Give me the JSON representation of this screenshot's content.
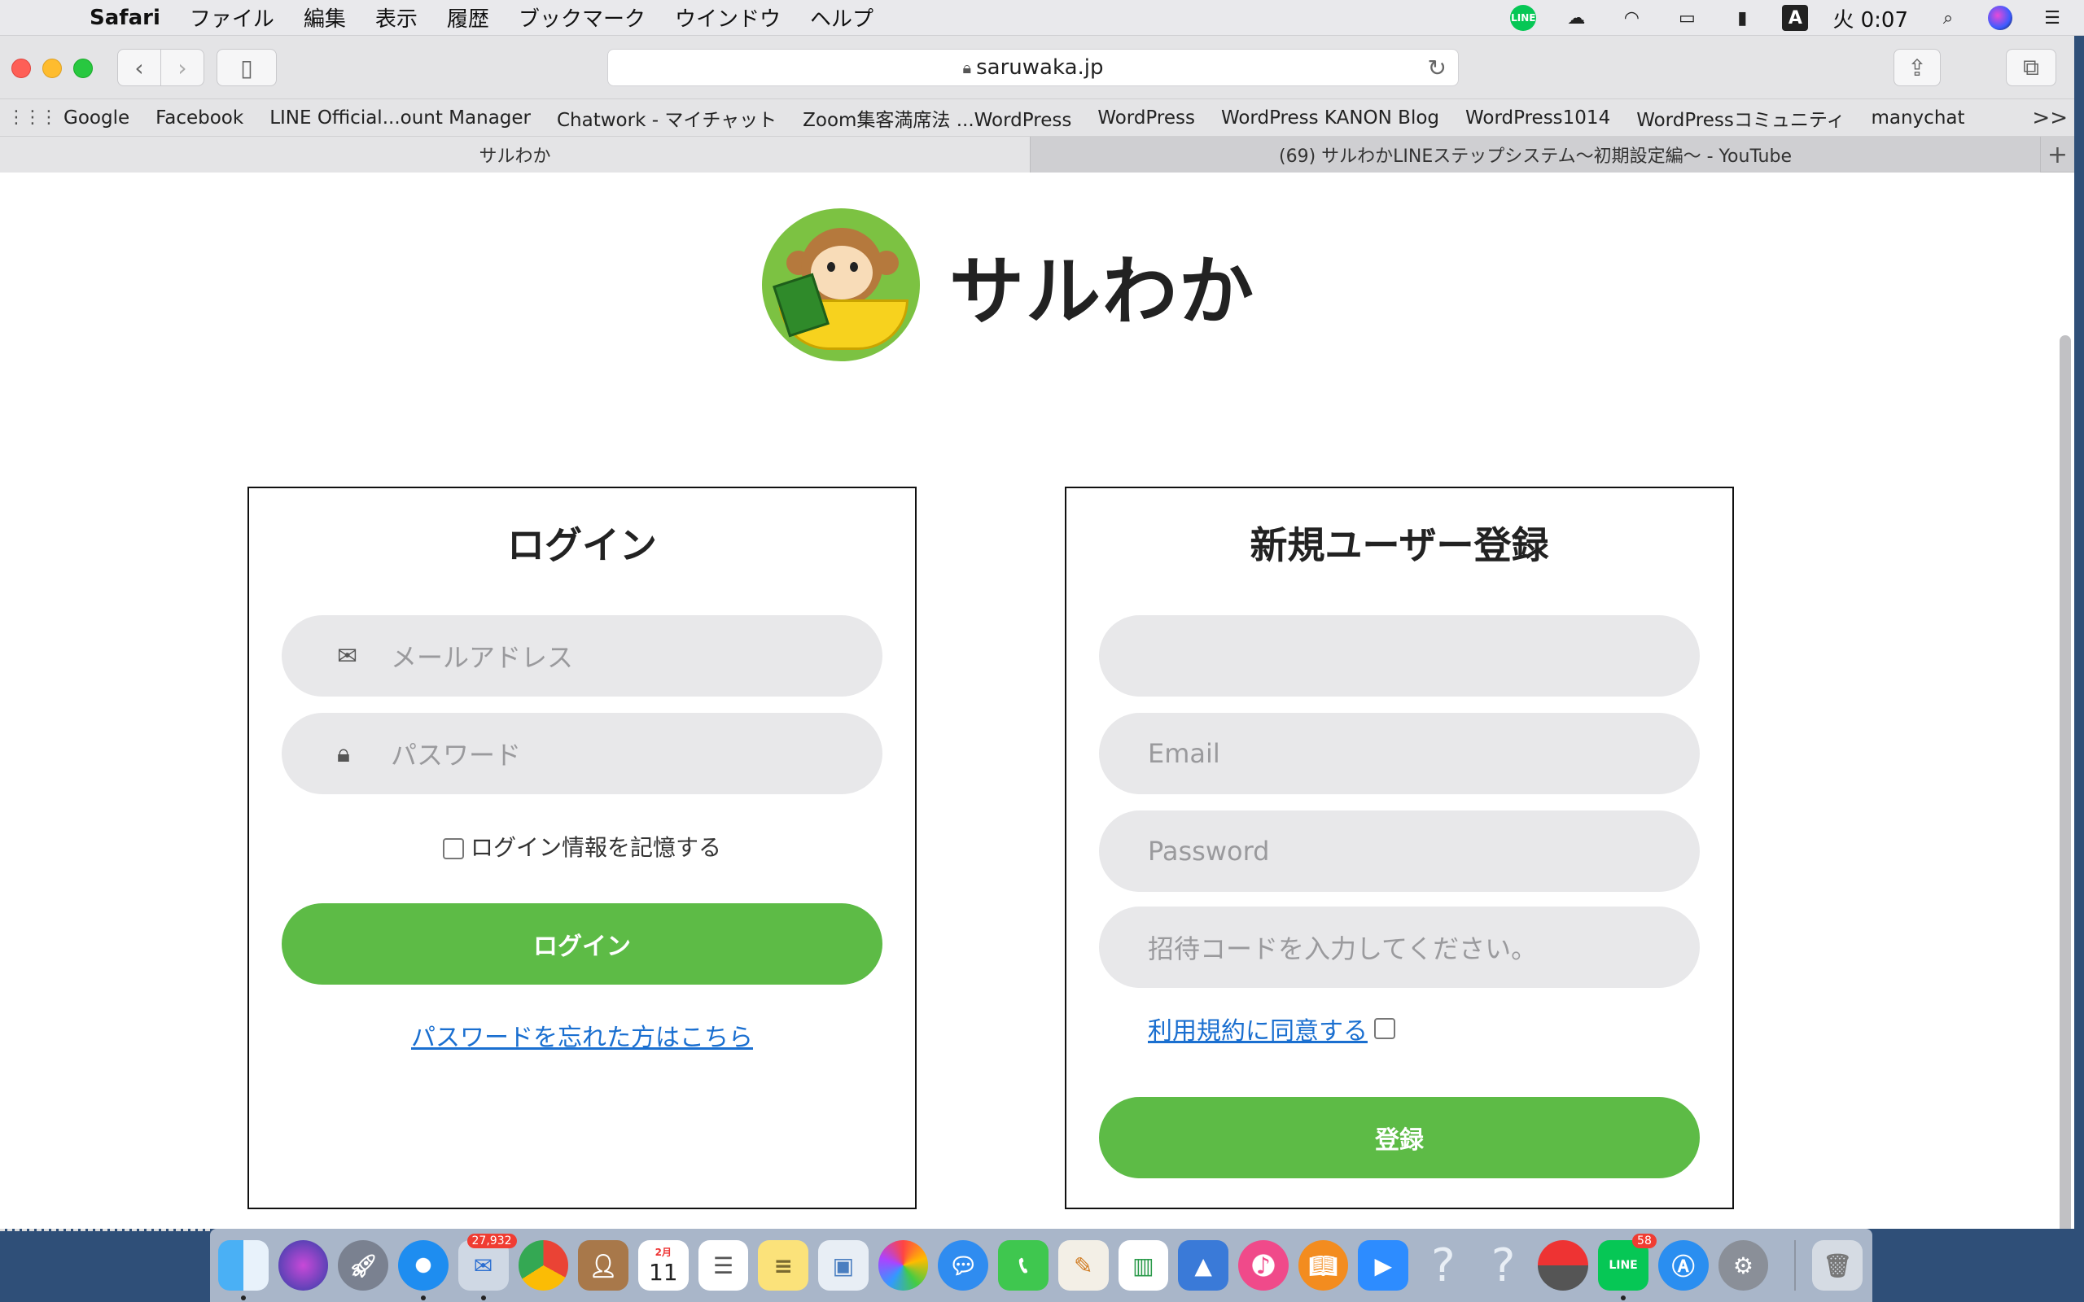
{
  "menubar": {
    "app_name": "Safari",
    "menus": [
      "ファイル",
      "編集",
      "表示",
      "履歴",
      "ブックマーク",
      "ウインドウ",
      "ヘルプ"
    ],
    "line_icon_label": "LINE",
    "input_source": "A",
    "clock": "火 0:07"
  },
  "browser": {
    "url": "saruwaka.jp",
    "bookmarks": [
      "Google",
      "Facebook",
      "LINE Official...ount Manager",
      "Chatwork - マイチャット",
      "Zoom集客満席法 ...WordPress",
      "WordPress",
      "WordPress KANON Blog",
      "WordPress1014",
      "WordPressコミュニティ",
      "manychat"
    ],
    "bookmarks_more": ">>",
    "tabs": [
      {
        "title": "サルわか",
        "active": true
      },
      {
        "title": "(69) サルわかLINEステップシステム〜初期設定編〜 - YouTube",
        "active": false
      }
    ],
    "new_tab_label": "+"
  },
  "page": {
    "logo_text": "サルわか",
    "login": {
      "title": "ログイン",
      "email_placeholder": "メールアドレス",
      "password_placeholder": "パスワード",
      "remember_label": "ログイン情報を記憶する",
      "remember_checked": false,
      "submit_label": "ログイン",
      "forgot_link": "パスワードを忘れた方はこちら"
    },
    "register": {
      "title": "新規ユーザー登録",
      "name_placeholder": "",
      "email_placeholder": "Email",
      "password_placeholder": "Password",
      "invite_placeholder": "招待コードを入力してください。",
      "terms_link": "利用規約に同意する",
      "terms_checked": false,
      "submit_label": "登録"
    }
  },
  "dock": {
    "mail_badge": "27,932",
    "calendar_month": "2月",
    "calendar_day": "11",
    "line_badge": "58"
  },
  "colors": {
    "accent_green": "#5dbb46",
    "link_blue": "#1a6fd0"
  }
}
